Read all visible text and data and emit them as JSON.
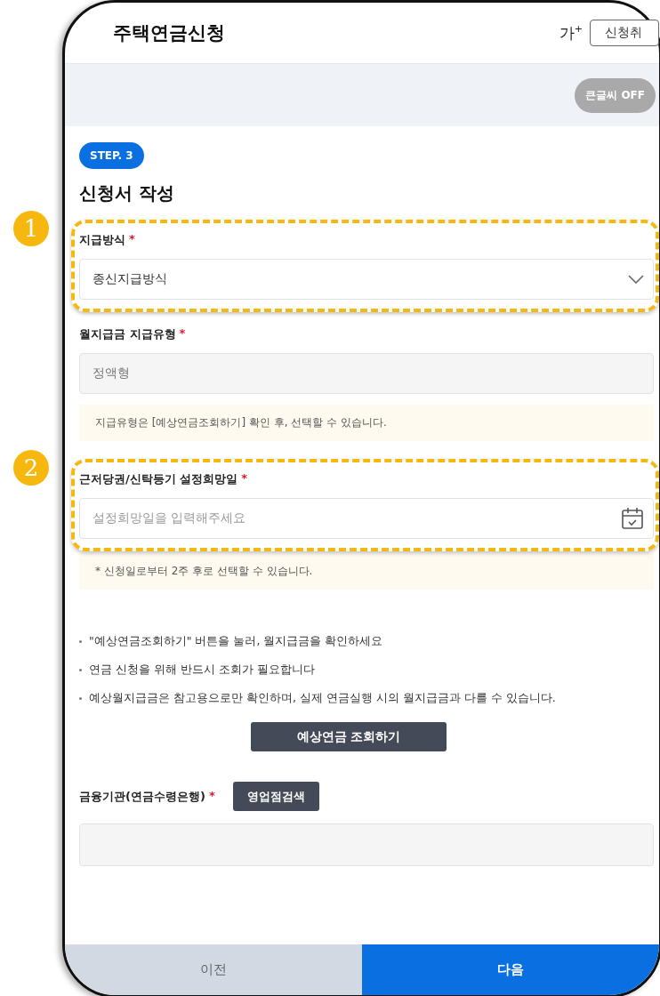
{
  "header": {
    "title": "주택연금신청",
    "font_size_button": "가",
    "font_size_mark": "+",
    "cancel_button": "신청취"
  },
  "large_text_toggle": {
    "label": "큰글씨 OFF",
    "on": false
  },
  "step_badge": "STEP. 3",
  "heading": "신청서 작성",
  "fields": [
    {
      "kind": "select",
      "label": "지급방식",
      "required_mark": "*",
      "value": "종신지급방식",
      "annotation": "1"
    },
    {
      "kind": "readonly",
      "label": "월지급금 지급유형",
      "required_mark": "*",
      "value": "정액형",
      "note": "지급유형은 [예상연금조회하기] 확인 후, 선택할 수 있습니다."
    },
    {
      "kind": "date",
      "label": "근저당권/신탁등기 설정희망일",
      "required_mark": "*",
      "placeholder": "설정희망일을 입력해주세요",
      "note": "* 신청일로부터 2주 후로 선택할 수 있습니다.",
      "annotation": "2"
    }
  ],
  "notices": [
    "\"예상연금조회하기\" 버튼을 눌러, 월지급금을 확인하세요",
    "연금 신청을 위해 반드시 조회가 필요합니다",
    "예상월지급금은 참고용으로만 확인하며, 실제 연금실행 시의 월지급금과 다를 수 있습니다."
  ],
  "estimate_button": "예상연금 조회하기",
  "bank_field": {
    "label": "금융기관(연금수령은행)",
    "required_mark": "*",
    "search_button": "영업점검색"
  },
  "nav": [
    {
      "label": "이전",
      "primary": false
    },
    {
      "label": "다음",
      "primary": true
    }
  ]
}
